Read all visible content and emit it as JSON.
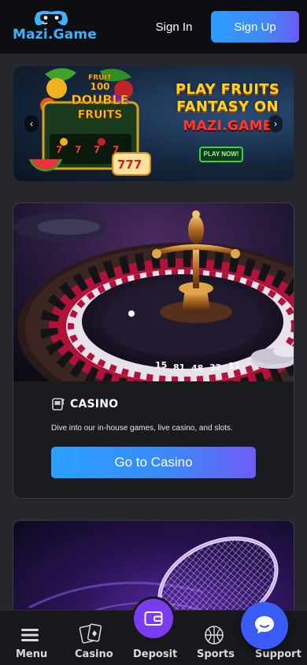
{
  "header": {
    "logo_text": "Mazi.Game",
    "signin_label": "Sign In",
    "signup_label": "Sign Up"
  },
  "banner": {
    "promo_line_1": "PLAY FRUITS",
    "promo_line_2": "FANTASY ON",
    "promo_line_3": "MAZI.GAME",
    "game_title_top": "FRUIT",
    "game_title_number": "100",
    "game_title_line_1": "DOUBLE",
    "game_title_line_2": "FRUITS",
    "play_now_label": "PLAY NOW!",
    "prev_icon": "chevron-left-icon",
    "next_icon": "chevron-right-icon"
  },
  "casino_card": {
    "title": "CASINO",
    "description": "Dive into our in-house games, live casino, and slots.",
    "button_label": "Go to Casino",
    "wheel_numbers": [
      "15",
      "81",
      "48",
      "32",
      "11"
    ]
  },
  "bottom_nav": {
    "items": [
      {
        "label": "Menu",
        "icon": "menu-icon"
      },
      {
        "label": "Casino",
        "icon": "cards-icon"
      },
      {
        "label": "Deposit",
        "icon": "wallet-icon"
      },
      {
        "label": "Sports",
        "icon": "basketball-icon"
      },
      {
        "label": "Support",
        "icon": "chat-icon"
      }
    ]
  },
  "colors": {
    "accent_blue": "#2d9cff",
    "accent_purple": "#6b5cf6",
    "deposit_purple": "#7b3cf0",
    "support_blue": "#3a5bf5",
    "logo_blue": "#3db2ff",
    "background": "#25272c"
  }
}
